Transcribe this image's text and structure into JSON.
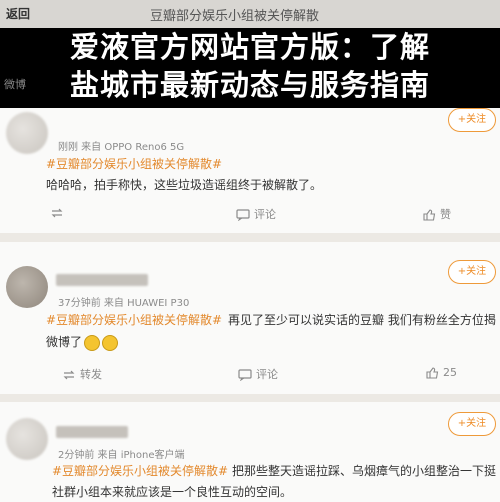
{
  "topbar": {
    "back_label": "返回",
    "title": "豆瓣部分娱乐小组被关停解散"
  },
  "overlay": {
    "line1": "爱液官方网站官方版：了解",
    "line2": "盐城市最新动态与服务指南"
  },
  "ghost": {
    "left_text": "微博"
  },
  "follow_label": "+关注",
  "comments": [
    {
      "meta": "刚刚 来自 OPPO Reno6 5G",
      "tag": "#豆瓣部分娱乐小组被关停解散#",
      "body_line1": "哈哈哈，拍手称快，这些垃圾造谣组终于被解散了。",
      "actions": {
        "repost": "",
        "comment": "评论",
        "like": "赞"
      }
    },
    {
      "meta": "37分钟前 来自 HUAWEI P30",
      "tag": "#豆瓣部分娱乐小组被关停解散#",
      "body_line1": "再见了至少可以说实话的豆瓣 我们有粉丝全方位揭",
      "body_line2": "微博了",
      "actions": {
        "repost": "转发",
        "comment": "评论",
        "like": "25"
      }
    },
    {
      "meta": "2分钟前 来自 iPhone客户端",
      "tag": "#豆瓣部分娱乐小组被关停解散#",
      "body_line1": "把那些整天造谣拉踩、乌烟瘴气的小组整治一下挺",
      "body_line2": "社群小组本来就应该是一个良性互动的空间。"
    }
  ],
  "colors": {
    "accent": "#ee8b25",
    "tag": "#e3892d",
    "overlay_bg": "#000000"
  }
}
